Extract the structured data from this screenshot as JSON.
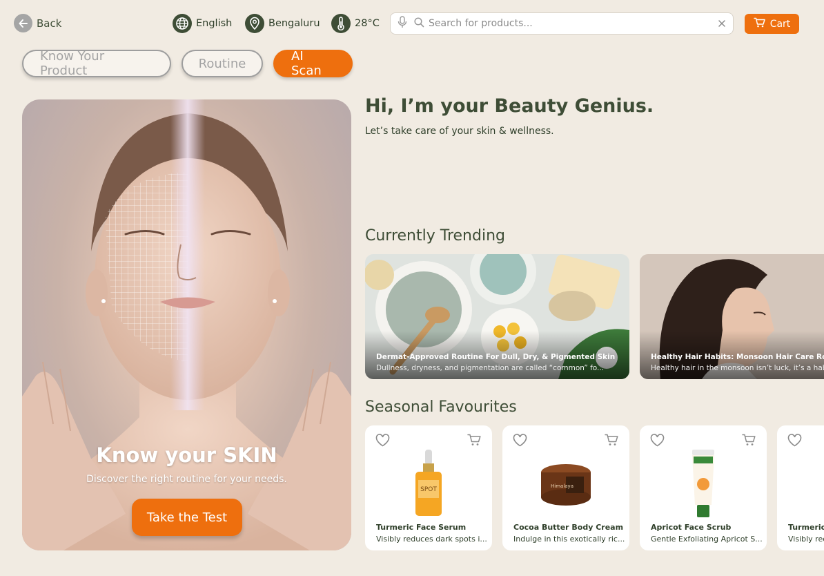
{
  "topbar": {
    "back_label": "Back",
    "language": "English",
    "location": "Bengaluru",
    "temperature": "28°C",
    "search_placeholder": "Search for products...",
    "cart_label": "Cart"
  },
  "tabs": [
    {
      "label": "Know Your Product",
      "active": false
    },
    {
      "label": "Routine",
      "active": false
    },
    {
      "label": "AI Scan",
      "active": true
    }
  ],
  "hero": {
    "title": "Know your SKIN",
    "subtitle": "Discover the right routine for your needs.",
    "button_label": "Take the Test"
  },
  "greeting": {
    "title": "Hi, I’m your Beauty Genius.",
    "subtitle": "Let’s take care of your skin & wellness."
  },
  "trending": {
    "heading": "Currently Trending",
    "items": [
      {
        "title": "Dermat-Approved Routine For Dull, Dry, & Pigmented Skin",
        "desc": "Dullness, dryness, and pigmentation are called “common” fo..."
      },
      {
        "title": "Healthy Hair Habits: Monsoon Hair Care Routine",
        "desc": "Healthy hair in the monsoon isn’t luck, it’s a habit"
      }
    ]
  },
  "seasonal": {
    "heading": "Seasonal Favourites",
    "items": [
      {
        "name": "Turmeric Face Serum",
        "desc": "Visibly reduces dark spots i..."
      },
      {
        "name": "Cocoa Butter Body Cream",
        "desc": "Indulge in this exotically ric..."
      },
      {
        "name": "Apricot Face Scrub",
        "desc": "Gentle Exfoliating Apricot S..."
      },
      {
        "name": "Turmeric Face Serum",
        "desc": "Visibly reduces dark spots i..."
      }
    ]
  },
  "colors": {
    "accent": "#ee6f0e",
    "background": "#f1ebe2",
    "brand_green": "#3e4d36"
  },
  "icons": [
    "back-arrow-icon",
    "globe-icon",
    "location-pin-icon",
    "thermometer-icon",
    "microphone-icon",
    "search-icon",
    "clear-icon",
    "cart-icon",
    "heart-icon"
  ]
}
